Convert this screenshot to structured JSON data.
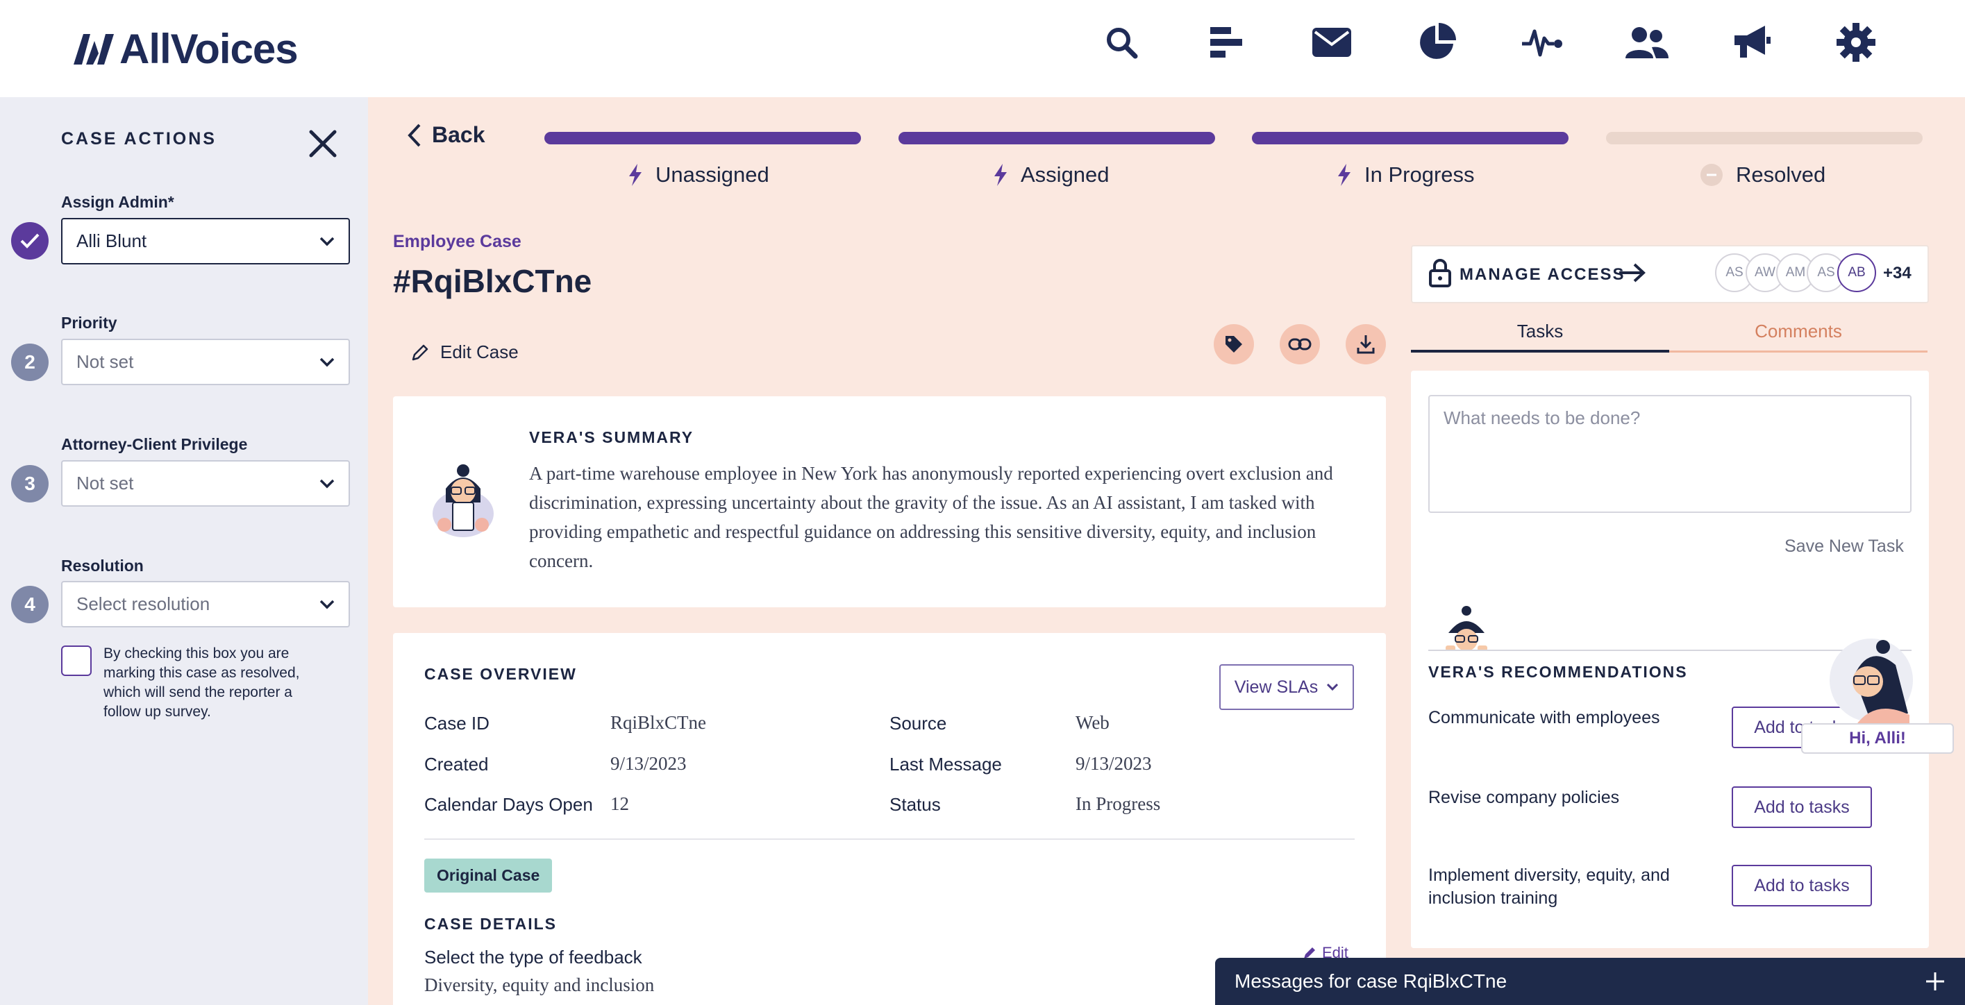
{
  "app": {
    "logo_text": "AllVoices"
  },
  "nav": {
    "icons": [
      "search-icon",
      "tasks-icon",
      "mail-icon",
      "reports-pie-icon",
      "activity-pulse-icon",
      "users-icon",
      "announcements-megaphone-icon",
      "settings-gear-icon"
    ]
  },
  "sidebar": {
    "title": "CASE ACTIONS",
    "assign_admin": {
      "label": "Assign Admin*",
      "value": "Alli Blunt"
    },
    "priority": {
      "step": "2",
      "label": "Priority",
      "value": "Not set"
    },
    "privilege": {
      "step": "3",
      "label": "Attorney-Client Privilege",
      "value": "Not set"
    },
    "resolution": {
      "step": "4",
      "label": "Resolution",
      "value": "Select resolution"
    },
    "resolve_note": "By checking this box you are marking this case as resolved, which will send the reporter a follow up survey."
  },
  "progress": {
    "back_label": "Back",
    "stages": [
      {
        "label": "Unassigned",
        "complete": true
      },
      {
        "label": "Assigned",
        "complete": true
      },
      {
        "label": "In Progress",
        "complete": true
      },
      {
        "label": "Resolved",
        "complete": false
      }
    ],
    "colors": {
      "complete": "#5b3a9c",
      "incomplete": "#ead6cc"
    }
  },
  "case": {
    "type": "Employee Case",
    "id_title": "#RqiBlxCTne",
    "edit_label": "Edit Case"
  },
  "summary": {
    "title": "VERA'S SUMMARY",
    "text": "A part-time warehouse employee in New York has anonymously reported experiencing overt exclusion and discrimination, expressing uncertainty about the gravity of the issue. As an AI assistant, I am tasked with providing empathetic and respectful guidance on addressing this sensitive diversity, equity, and inclusion concern."
  },
  "overview": {
    "title": "CASE OVERVIEW",
    "view_slas": "View SLAs",
    "case_id_label": "Case ID",
    "case_id": "RqiBlxCTne",
    "created_label": "Created",
    "created": "9/13/2023",
    "days_open_label": "Calendar Days Open",
    "days_open": "12",
    "source_label": "Source",
    "source": "Web",
    "last_message_label": "Last Message",
    "last_message": "9/13/2023",
    "status_label": "Status",
    "status": "In Progress",
    "original_badge": "Original Case",
    "details_title": "CASE DETAILS",
    "details_question": "Select the type of feedback",
    "details_answer": "Diversity, equity and inclusion",
    "details_edit": "Edit"
  },
  "access": {
    "label": "MANAGE ACCESS",
    "avatars": [
      "AS",
      "AW",
      "AM",
      "AS",
      "AB"
    ],
    "more": "+34"
  },
  "tabs": {
    "tasks": "Tasks",
    "comments": "Comments"
  },
  "tasks": {
    "placeholder": "What needs to be done?",
    "save_label": "Save New Task"
  },
  "recommendations": {
    "title": "VERA'S RECOMMENDATIONS",
    "items": [
      {
        "text": "Communicate with employees",
        "button": "Add to tasks"
      },
      {
        "text": "Revise company policies",
        "button": "Add to tasks"
      },
      {
        "text": "Implement diversity, equity, and inclusion training",
        "button": "Add to tasks"
      }
    ]
  },
  "chat": {
    "greeting": "Hi, Alli!"
  },
  "messages": {
    "label": "Messages for case RqiBlxCTne"
  }
}
